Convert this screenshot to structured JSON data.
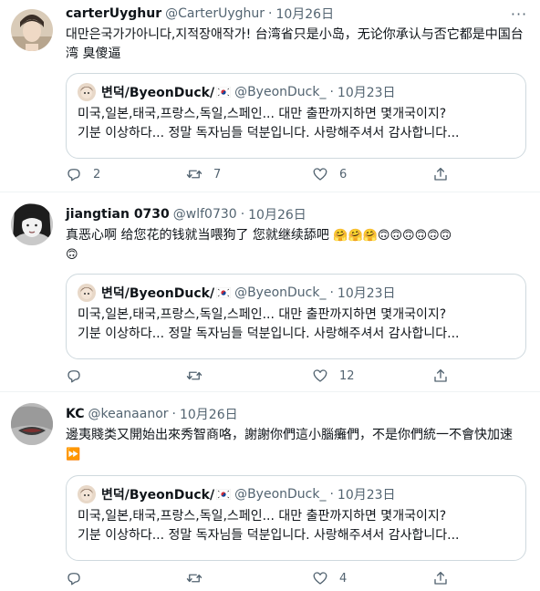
{
  "tweets": [
    {
      "name": "carterUyghur",
      "handle": "@CarterUyghur",
      "sep": "·",
      "date": "10月26日",
      "text": "대만은국가가아니다,지적장애작가!  台湾省只是小岛，无论你承认与否它都是中国台湾 臭傻逼",
      "quote": {
        "name": "변덕/ByeonDuck/",
        "handle": "@ByeonDuck_",
        "sep": "·",
        "date": "10月23日",
        "line1": "미국,일본,태국,프랑스,독일,스페인... 대만 출판까지하면 몇개국이지?",
        "line2": "기분 이상하다... 정말 독자님들 덕분입니다. 사랑해주셔서 감사합니다..."
      },
      "counts": {
        "reply": "2",
        "retweet": "7",
        "like": "6"
      }
    },
    {
      "name": "jiangtian 0730",
      "handle": "@wlf0730",
      "sep": "·",
      "date": "10月26日",
      "text": "真恶心啊 给您花的钱就当喂狗了 您就继续舔吧",
      "emoji_line": "🤗🤗🤗🙃🙃🙃🙃🙃🙃",
      "emoji_tail": "🙃",
      "quote": {
        "name": "변덕/ByeonDuck/",
        "handle": "@ByeonDuck_",
        "sep": "·",
        "date": "10月23日",
        "line1": "미국,일본,태국,프랑스,독일,스페인... 대만 출판까지하면 몇개국이지?",
        "line2": "기분 이상하다... 정말 독자님들 덕분입니다. 사랑해주셔서 감사합니다..."
      },
      "counts": {
        "reply": "",
        "retweet": "",
        "like": "12"
      }
    },
    {
      "name": "KC",
      "handle": "@keanaanor",
      "sep": "·",
      "date": "10月26日",
      "text": "邊夷賤类又開始出來秀智商咯，謝謝你們這小腦癱們，不是你們統一不會快加速",
      "emoji_tail": "⏩",
      "quote": {
        "name": "변덕/ByeonDuck/",
        "handle": "@ByeonDuck_",
        "sep": "·",
        "date": "10月23日",
        "line1": "미국,일본,태국,프랑스,독일,스페인... 대만 출판까지하면 몇개국이지?",
        "line2": "기분 이상하다... 정말 독자님들 덕분입니다. 사랑해주셔서 감사합니다..."
      },
      "counts": {
        "reply": "",
        "retweet": "",
        "like": "4"
      }
    }
  ],
  "icons": {
    "reply": "reply-icon",
    "retweet": "retweet-icon",
    "like": "heart-icon",
    "share": "share-icon",
    "more": "more-icon",
    "flag": "south-korea-flag-icon"
  },
  "colors": {
    "text": "#0f1419",
    "secondary": "#536471",
    "border": "#cfd9de",
    "divider": "#eff3f4"
  }
}
